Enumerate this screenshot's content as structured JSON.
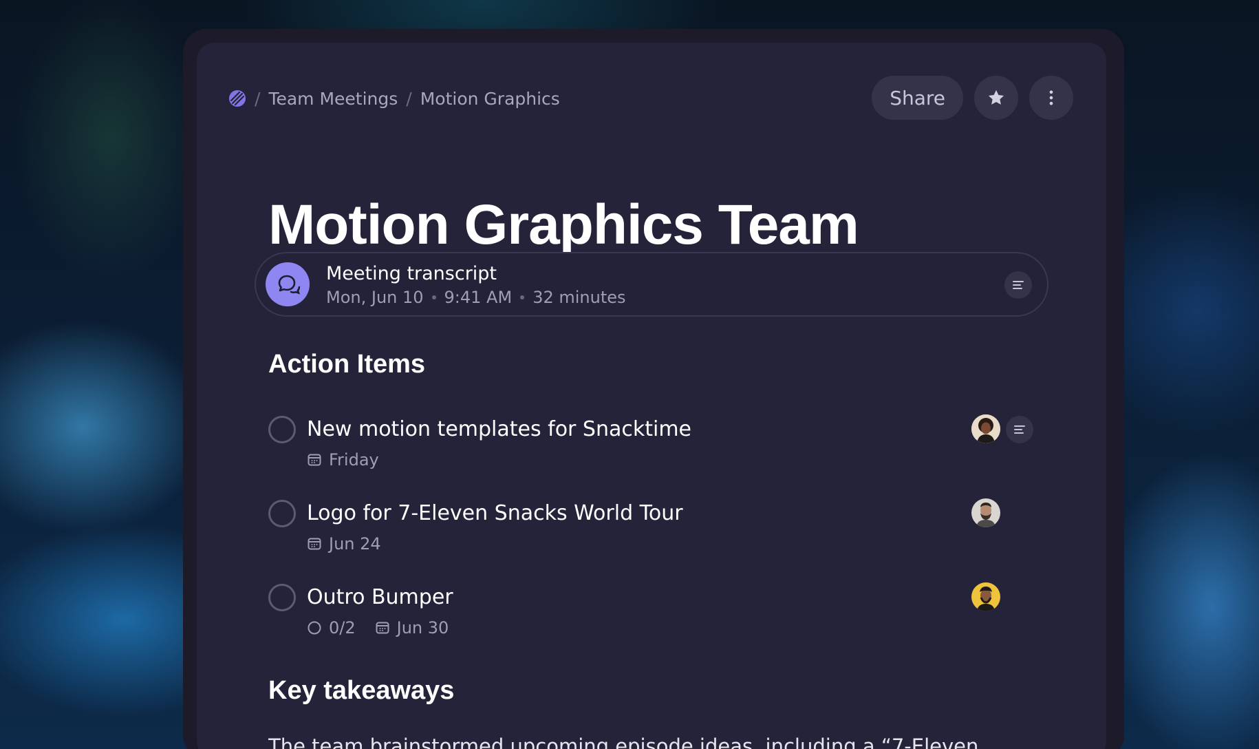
{
  "breadcrumb": {
    "logo_icon": "workspace-logo-icon",
    "items": [
      "Team Meetings",
      "Motion Graphics"
    ],
    "separator": "/"
  },
  "header": {
    "share_label": "Share",
    "star_icon": "star-icon",
    "more_icon": "more-vertical-icon"
  },
  "page": {
    "title": "Motion Graphics Team"
  },
  "transcript": {
    "icon": "chat-bubbles-icon",
    "title": "Meeting transcript",
    "date": "Mon, Jun 10",
    "time": "9:41 AM",
    "duration": "32 minutes",
    "menu_icon": "text-lines-icon"
  },
  "action_items": {
    "heading": "Action Items",
    "items": [
      {
        "title": "New motion templates for Snacktime",
        "due": "Friday",
        "subtasks": "",
        "has_menu": true
      },
      {
        "title": "Logo for 7-Eleven Snacks World Tour",
        "due": "Jun 24",
        "subtasks": "",
        "has_menu": false
      },
      {
        "title": "Outro Bumper",
        "due": "Jun 30",
        "subtasks": "0/2",
        "has_menu": false
      }
    ]
  },
  "key_takeaways": {
    "heading": "Key takeaways",
    "text": "The team brainstormed upcoming episode ideas, including a “7-Eleven"
  },
  "colors": {
    "accent": "#8f86f2",
    "panel": "#25233a",
    "frame": "#1d1b2a",
    "text_muted": "#a09eb6"
  }
}
